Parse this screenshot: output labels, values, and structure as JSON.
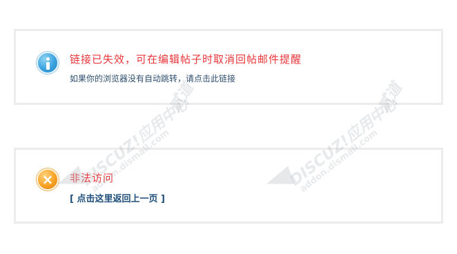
{
  "messages": [
    {
      "type": "info",
      "title": "链接已失效，可在编辑帖子时取消回帖邮件提醒",
      "subtitle": "如果你的浏览器没有自动跳转，请点击此链接"
    },
    {
      "type": "error",
      "title": "非法访问",
      "link_label": "[ 点击这里返回上一页 ]"
    }
  ],
  "icons": {
    "info": "i",
    "error": "×"
  },
  "watermark": {
    "brand": "DISCUZ!应用中心",
    "site": "addon.dismall.com",
    "extra": "贰道"
  },
  "colors": {
    "title": "#e8353a",
    "link": "#1e4e79",
    "info_icon": "#3aa3df",
    "error_icon": "#f7a327",
    "border": "#ececec"
  }
}
